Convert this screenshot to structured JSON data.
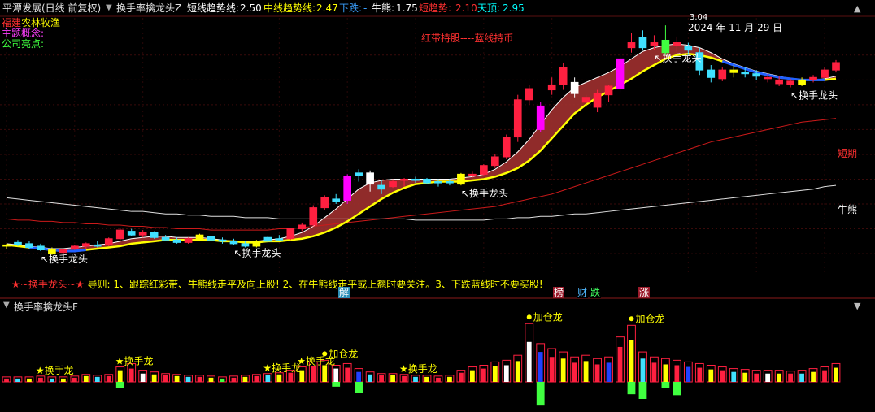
{
  "top_bar": {
    "stock_title": "平潭发展(日线 前复权)",
    "indicator_name": "换手率擒龙头Z",
    "readouts": [
      {
        "label": "短线趋势线:",
        "value": "2.50",
        "color": "#ffffff"
      },
      {
        "label": "中线趋势线:",
        "value": "2.47",
        "color": "#ffff00"
      },
      {
        "label": "下跌:",
        "value": "-",
        "color": "#3aa0ff"
      },
      {
        "label": "牛熊:",
        "value": "1.75",
        "color": "#ffffff"
      },
      {
        "label": "短趋势:",
        "value": "2.10",
        "color": "#ff3030"
      },
      {
        "label": "天顶:",
        "value": "2.95",
        "color": "#00ffff"
      }
    ]
  },
  "info_panel": {
    "industry_label": "福建",
    "industry_value": "农林牧渔",
    "theme_label": "主题概念:",
    "highlight_label": "公司亮点:"
  },
  "annotations": {
    "red_band_note": "红带持股----蓝线持币",
    "date_label": "2024 年 11 月 29 日",
    "peak_label": "3.04",
    "dragon_label": "换手龙头",
    "short_term_label": "短期",
    "bull_bear_label": "牛熊",
    "guide_star_text": "★~换手龙头~★",
    "guide_text": "导则: 1、跟踪红彩带、牛熊线走平及向上股! 2、在牛熊线走平或上翘时要关注。3、下跌蓝线时不要买股!",
    "bottom_tags": [
      {
        "text": "解",
        "bg": "#2d8fb8",
        "color": "#ffffff"
      },
      {
        "text": "榜",
        "bg": "#9a1a2a",
        "color": "#ffffff"
      },
      {
        "text": "财",
        "bg": "#000000",
        "color": "#4fb8ff"
      },
      {
        "text": "跌",
        "bg": "#000000",
        "color": "#40ff60"
      },
      {
        "text": "涨",
        "bg": "#9a1a2a",
        "color": "#ffffff"
      }
    ]
  },
  "sub_panel": {
    "title": "换手率擒龙头F",
    "add_label": "加仓龙",
    "dragon_label": "换手龙"
  },
  "controls": {
    "menu_icon": "chevron-down-icon",
    "up_icon": "caret-up-icon",
    "down_icon": "caret-down-icon"
  },
  "chart_data": {
    "type": "candlestick",
    "title": "",
    "xlabel": "",
    "ylabel": "",
    "ylim": [
      1.05,
      3.1
    ],
    "colors": {
      "up": "#ff2040",
      "down": "#40e0ff",
      "highlight_up": "#ff00ff",
      "highlight_down": "#ffffff",
      "signal": "#ffff00",
      "band": "#a0302f",
      "bear_line": "#2060ff",
      "short_trend": "#cc1a1a",
      "bull_bear": "#e0e0e0"
    },
    "candles": [
      {
        "o": 1.26,
        "h": 1.28,
        "l": 1.24,
        "c": 1.27,
        "t": "yellow"
      },
      {
        "o": 1.27,
        "h": 1.31,
        "l": 1.26,
        "c": 1.29,
        "t": "down"
      },
      {
        "o": 1.28,
        "h": 1.3,
        "l": 1.24,
        "c": 1.25,
        "t": "down"
      },
      {
        "o": 1.26,
        "h": 1.28,
        "l": 1.22,
        "c": 1.23,
        "t": "down"
      },
      {
        "o": 1.23,
        "h": 1.25,
        "l": 1.19,
        "c": 1.2,
        "t": "yellow"
      },
      {
        "o": 1.21,
        "h": 1.24,
        "l": 1.2,
        "c": 1.23,
        "t": "up"
      },
      {
        "o": 1.24,
        "h": 1.27,
        "l": 1.23,
        "c": 1.26,
        "t": "up"
      },
      {
        "o": 1.26,
        "h": 1.29,
        "l": 1.24,
        "c": 1.28,
        "t": "up"
      },
      {
        "o": 1.27,
        "h": 1.3,
        "l": 1.25,
        "c": 1.26,
        "t": "down"
      },
      {
        "o": 1.27,
        "h": 1.33,
        "l": 1.26,
        "c": 1.32,
        "t": "up"
      },
      {
        "o": 1.32,
        "h": 1.41,
        "l": 1.3,
        "c": 1.39,
        "t": "up"
      },
      {
        "o": 1.38,
        "h": 1.4,
        "l": 1.34,
        "c": 1.35,
        "t": "down"
      },
      {
        "o": 1.35,
        "h": 1.39,
        "l": 1.33,
        "c": 1.37,
        "t": "up"
      },
      {
        "o": 1.37,
        "h": 1.38,
        "l": 1.32,
        "c": 1.33,
        "t": "down"
      },
      {
        "o": 1.33,
        "h": 1.35,
        "l": 1.3,
        "c": 1.31,
        "t": "down"
      },
      {
        "o": 1.31,
        "h": 1.33,
        "l": 1.28,
        "c": 1.29,
        "t": "down"
      },
      {
        "o": 1.29,
        "h": 1.33,
        "l": 1.28,
        "c": 1.32,
        "t": "up"
      },
      {
        "o": 1.31,
        "h": 1.36,
        "l": 1.3,
        "c": 1.35,
        "t": "yellow"
      },
      {
        "o": 1.34,
        "h": 1.36,
        "l": 1.3,
        "c": 1.31,
        "t": "down"
      },
      {
        "o": 1.31,
        "h": 1.33,
        "l": 1.28,
        "c": 1.3,
        "t": "down"
      },
      {
        "o": 1.3,
        "h": 1.32,
        "l": 1.27,
        "c": 1.28,
        "t": "down"
      },
      {
        "o": 1.28,
        "h": 1.3,
        "l": 1.25,
        "c": 1.26,
        "t": "down"
      },
      {
        "o": 1.26,
        "h": 1.31,
        "l": 1.25,
        "c": 1.3,
        "t": "yellow"
      },
      {
        "o": 1.3,
        "h": 1.34,
        "l": 1.29,
        "c": 1.33,
        "t": "down"
      },
      {
        "o": 1.32,
        "h": 1.35,
        "l": 1.3,
        "c": 1.31,
        "t": "down"
      },
      {
        "o": 1.32,
        "h": 1.41,
        "l": 1.31,
        "c": 1.4,
        "t": "up"
      },
      {
        "o": 1.4,
        "h": 1.45,
        "l": 1.38,
        "c": 1.43,
        "t": "up"
      },
      {
        "o": 1.43,
        "h": 1.59,
        "l": 1.42,
        "c": 1.57,
        "t": "up"
      },
      {
        "o": 1.57,
        "h": 1.67,
        "l": 1.55,
        "c": 1.65,
        "t": "up"
      },
      {
        "o": 1.64,
        "h": 1.68,
        "l": 1.6,
        "c": 1.62,
        "t": "down"
      },
      {
        "o": 1.63,
        "h": 1.84,
        "l": 1.6,
        "c": 1.82,
        "t": "magenta"
      },
      {
        "o": 1.83,
        "h": 1.88,
        "l": 1.78,
        "c": 1.85,
        "t": "down"
      },
      {
        "o": 1.85,
        "h": 1.87,
        "l": 1.7,
        "c": 1.76,
        "t": "white"
      },
      {
        "o": 1.75,
        "h": 1.79,
        "l": 1.68,
        "c": 1.72,
        "t": "down"
      },
      {
        "o": 1.74,
        "h": 1.8,
        "l": 1.73,
        "c": 1.78,
        "t": "up"
      },
      {
        "o": 1.79,
        "h": 1.81,
        "l": 1.74,
        "c": 1.8,
        "t": "up"
      },
      {
        "o": 1.8,
        "h": 1.82,
        "l": 1.77,
        "c": 1.79,
        "t": "down"
      },
      {
        "o": 1.8,
        "h": 1.81,
        "l": 1.76,
        "c": 1.77,
        "t": "down"
      },
      {
        "o": 1.77,
        "h": 1.8,
        "l": 1.74,
        "c": 1.78,
        "t": "down"
      },
      {
        "o": 1.78,
        "h": 1.8,
        "l": 1.75,
        "c": 1.77,
        "t": "down"
      },
      {
        "o": 1.76,
        "h": 1.85,
        "l": 1.75,
        "c": 1.84,
        "t": "yellow"
      },
      {
        "o": 1.84,
        "h": 1.86,
        "l": 1.81,
        "c": 1.84,
        "t": "up"
      },
      {
        "o": 1.84,
        "h": 1.92,
        "l": 1.83,
        "c": 1.91,
        "t": "up"
      },
      {
        "o": 1.91,
        "h": 2.0,
        "l": 1.89,
        "c": 1.98,
        "t": "up"
      },
      {
        "o": 1.98,
        "h": 2.16,
        "l": 1.96,
        "c": 2.14,
        "t": "up"
      },
      {
        "o": 2.14,
        "h": 2.48,
        "l": 2.1,
        "c": 2.44,
        "t": "up"
      },
      {
        "o": 2.44,
        "h": 2.56,
        "l": 2.4,
        "c": 2.53,
        "t": "up"
      },
      {
        "o": 2.2,
        "h": 2.42,
        "l": 2.18,
        "c": 2.39,
        "t": "magenta"
      },
      {
        "o": 2.56,
        "h": 2.62,
        "l": 2.48,
        "c": 2.52,
        "t": "up"
      },
      {
        "o": 2.56,
        "h": 2.74,
        "l": 2.52,
        "c": 2.7,
        "t": "up"
      },
      {
        "o": 2.58,
        "h": 2.62,
        "l": 2.46,
        "c": 2.49,
        "t": "white"
      },
      {
        "o": 2.46,
        "h": 2.48,
        "l": 2.38,
        "c": 2.42,
        "t": "up"
      },
      {
        "o": 2.38,
        "h": 2.52,
        "l": 2.34,
        "c": 2.49,
        "t": "up"
      },
      {
        "o": 2.48,
        "h": 2.56,
        "l": 2.42,
        "c": 2.55,
        "t": "up"
      },
      {
        "o": 2.53,
        "h": 2.82,
        "l": 2.5,
        "c": 2.77,
        "t": "magenta"
      },
      {
        "o": 2.86,
        "h": 2.98,
        "l": 2.82,
        "c": 2.9,
        "t": "up"
      },
      {
        "o": 2.94,
        "h": 3.0,
        "l": 2.84,
        "c": 2.86,
        "t": "down"
      },
      {
        "o": 2.9,
        "h": 2.96,
        "l": 2.84,
        "c": 2.88,
        "t": "up"
      },
      {
        "o": 2.92,
        "h": 3.04,
        "l": 2.8,
        "c": 2.82,
        "t": "green"
      },
      {
        "o": 2.9,
        "h": 2.95,
        "l": 2.82,
        "c": 2.88,
        "t": "up"
      },
      {
        "o": 2.87,
        "h": 2.9,
        "l": 2.8,
        "c": 2.84,
        "t": "down"
      },
      {
        "o": 2.82,
        "h": 2.86,
        "l": 2.64,
        "c": 2.68,
        "t": "down"
      },
      {
        "o": 2.68,
        "h": 2.72,
        "l": 2.58,
        "c": 2.62,
        "t": "down"
      },
      {
        "o": 2.61,
        "h": 2.7,
        "l": 2.59,
        "c": 2.68,
        "t": "up"
      },
      {
        "o": 2.68,
        "h": 2.72,
        "l": 2.62,
        "c": 2.66,
        "t": "yellow"
      },
      {
        "o": 2.66,
        "h": 2.7,
        "l": 2.62,
        "c": 2.65,
        "t": "down"
      },
      {
        "o": 2.65,
        "h": 2.68,
        "l": 2.6,
        "c": 2.63,
        "t": "down"
      },
      {
        "o": 2.62,
        "h": 2.65,
        "l": 2.58,
        "c": 2.61,
        "t": "up"
      },
      {
        "o": 2.6,
        "h": 2.63,
        "l": 2.55,
        "c": 2.57,
        "t": "up"
      },
      {
        "o": 2.59,
        "h": 2.61,
        "l": 2.54,
        "c": 2.56,
        "t": "up"
      },
      {
        "o": 2.56,
        "h": 2.62,
        "l": 2.55,
        "c": 2.6,
        "t": "yellow"
      },
      {
        "o": 2.6,
        "h": 2.64,
        "l": 2.58,
        "c": 2.62,
        "t": "up"
      },
      {
        "o": 2.62,
        "h": 2.7,
        "l": 2.61,
        "c": 2.68,
        "t": "up"
      },
      {
        "o": 2.68,
        "h": 2.76,
        "l": 2.66,
        "c": 2.74,
        "t": "up"
      }
    ],
    "short_trend": [
      1.28,
      1.27,
      1.26,
      1.25,
      1.24,
      1.24,
      1.25,
      1.26,
      1.27,
      1.28,
      1.3,
      1.32,
      1.33,
      1.34,
      1.34,
      1.33,
      1.33,
      1.33,
      1.32,
      1.31,
      1.3,
      1.3,
      1.3,
      1.31,
      1.32,
      1.34,
      1.37,
      1.42,
      1.49,
      1.56,
      1.64,
      1.72,
      1.77,
      1.79,
      1.8,
      1.8,
      1.8,
      1.8,
      1.8,
      1.8,
      1.81,
      1.82,
      1.84,
      1.88,
      1.94,
      2.02,
      2.12,
      2.24,
      2.36,
      2.46,
      2.54,
      2.58,
      2.62,
      2.66,
      2.71,
      2.77,
      2.83,
      2.86,
      2.88,
      2.89,
      2.88,
      2.86,
      2.82,
      2.77,
      2.73,
      2.7,
      2.67,
      2.65,
      2.63,
      2.61,
      2.6,
      2.6,
      2.61,
      2.63
    ],
    "mid_trend": [
      1.27,
      1.26,
      1.25,
      1.24,
      1.23,
      1.22,
      1.22,
      1.23,
      1.24,
      1.25,
      1.26,
      1.28,
      1.29,
      1.3,
      1.31,
      1.31,
      1.31,
      1.31,
      1.31,
      1.3,
      1.3,
      1.29,
      1.29,
      1.3,
      1.3,
      1.31,
      1.32,
      1.34,
      1.37,
      1.41,
      1.46,
      1.52,
      1.58,
      1.64,
      1.69,
      1.73,
      1.76,
      1.77,
      1.78,
      1.78,
      1.78,
      1.79,
      1.8,
      1.82,
      1.85,
      1.89,
      1.95,
      2.03,
      2.13,
      2.23,
      2.33,
      2.4,
      2.46,
      2.51,
      2.56,
      2.61,
      2.67,
      2.72,
      2.77,
      2.8,
      2.81,
      2.8,
      2.78,
      2.75,
      2.72,
      2.69,
      2.66,
      2.64,
      2.62,
      2.61,
      2.6,
      2.6,
      2.6,
      2.61
    ],
    "bear_segments": [
      [
        2,
        7
      ],
      [
        63,
        72
      ]
    ],
    "short_term_ma": [
      1.48,
      1.47,
      1.47,
      1.46,
      1.46,
      1.45,
      1.45,
      1.44,
      1.44,
      1.43,
      1.43,
      1.42,
      1.42,
      1.41,
      1.41,
      1.4,
      1.4,
      1.4,
      1.39,
      1.39,
      1.39,
      1.39,
      1.39,
      1.39,
      1.4,
      1.4,
      1.41,
      1.42,
      1.43,
      1.44,
      1.45,
      1.46,
      1.47,
      1.48,
      1.49,
      1.5,
      1.51,
      1.52,
      1.53,
      1.54,
      1.55,
      1.56,
      1.57,
      1.58,
      1.6,
      1.62,
      1.64,
      1.66,
      1.68,
      1.71,
      1.74,
      1.77,
      1.8,
      1.83,
      1.86,
      1.89,
      1.92,
      1.95,
      1.98,
      2.01,
      2.04,
      2.07,
      2.1,
      2.12,
      2.14,
      2.16,
      2.18,
      2.2,
      2.22,
      2.24,
      2.26,
      2.27,
      2.28,
      2.29
    ],
    "bull_bear_ma": [
      1.65,
      1.64,
      1.63,
      1.62,
      1.61,
      1.6,
      1.59,
      1.58,
      1.57,
      1.56,
      1.55,
      1.54,
      1.54,
      1.53,
      1.52,
      1.52,
      1.51,
      1.51,
      1.5,
      1.5,
      1.5,
      1.49,
      1.49,
      1.49,
      1.48,
      1.48,
      1.48,
      1.48,
      1.48,
      1.48,
      1.48,
      1.48,
      1.48,
      1.48,
      1.48,
      1.48,
      1.47,
      1.47,
      1.47,
      1.47,
      1.47,
      1.47,
      1.47,
      1.48,
      1.48,
      1.49,
      1.49,
      1.5,
      1.5,
      1.51,
      1.52,
      1.52,
      1.53,
      1.54,
      1.55,
      1.56,
      1.57,
      1.58,
      1.59,
      1.6,
      1.61,
      1.62,
      1.63,
      1.64,
      1.65,
      1.66,
      1.67,
      1.68,
      1.69,
      1.7,
      1.71,
      1.72,
      1.74,
      1.75
    ],
    "dragon_signals": [
      3,
      20,
      40,
      57,
      69
    ],
    "sub_chart": {
      "type": "bar",
      "ylim": [
        -3,
        8
      ],
      "outer": [
        0.6,
        0.6,
        0.6,
        0.7,
        0.6,
        0.6,
        0.7,
        0.9,
        0.8,
        0.9,
        1.8,
        2.2,
        1.4,
        1.2,
        1.0,
        0.9,
        0.8,
        0.8,
        0.7,
        0.6,
        0.7,
        0.8,
        0.9,
        1.0,
        1.1,
        1.4,
        1.8,
        2.4,
        2.6,
        2.0,
        2.2,
        1.6,
        1.2,
        1.0,
        1.0,
        0.9,
        0.8,
        0.8,
        0.7,
        0.8,
        1.4,
        1.8,
        2.0,
        2.4,
        2.6,
        3.2,
        7.0,
        4.6,
        4.0,
        3.6,
        3.0,
        3.2,
        2.8,
        3.0,
        5.4,
        6.8,
        3.6,
        3.0,
        2.8,
        2.6,
        2.4,
        2.2,
        2.0,
        1.8,
        1.6,
        1.5,
        1.4,
        1.4,
        1.4,
        1.3,
        1.4,
        1.6,
        1.8,
        2.2
      ],
      "inner": [
        0.4,
        0.4,
        0.4,
        0.5,
        0.4,
        0.4,
        0.5,
        0.7,
        0.6,
        0.7,
        1.4,
        1.6,
        1.0,
        0.9,
        0.8,
        0.7,
        0.6,
        0.6,
        0.5,
        0.4,
        0.5,
        0.6,
        0.7,
        0.8,
        0.9,
        1.1,
        1.4,
        1.9,
        2.0,
        1.6,
        1.7,
        1.2,
        0.9,
        0.8,
        0.8,
        0.7,
        0.6,
        0.6,
        0.5,
        0.6,
        1.1,
        1.4,
        1.6,
        1.9,
        2.0,
        2.5,
        4.8,
        3.6,
        3.0,
        2.8,
        2.3,
        2.5,
        2.1,
        2.3,
        4.2,
        5.0,
        2.8,
        2.3,
        2.1,
        2.0,
        1.8,
        1.7,
        1.5,
        1.4,
        1.2,
        1.1,
        1.0,
        1.0,
        1.0,
        1.0,
        1.0,
        1.2,
        1.4,
        1.7
      ],
      "inner_kind": [
        "r",
        "c",
        "y",
        "r",
        "c",
        "y",
        "r",
        "y",
        "c",
        "r",
        "y",
        "r",
        "w",
        "y",
        "r",
        "y",
        "c",
        "r",
        "y",
        "g",
        "r",
        "y",
        "r",
        "c",
        "y",
        "r",
        "y",
        "r",
        "y",
        "w",
        "r",
        "b",
        "c",
        "r",
        "y",
        "r",
        "c",
        "y",
        "r",
        "y",
        "r",
        "y",
        "r",
        "y",
        "w",
        "y",
        "w",
        "b",
        "r",
        "y",
        "r",
        "y",
        "r",
        "b",
        "r",
        "y",
        "c",
        "r",
        "y",
        "r",
        "b",
        "r",
        "y",
        "r",
        "c",
        "y",
        "r",
        "w",
        "y",
        "r",
        "c",
        "y",
        "r",
        "y"
      ],
      "negative": [
        0,
        0,
        0,
        0,
        0,
        0,
        0,
        0,
        0,
        0,
        0.6,
        0,
        0,
        0,
        0,
        0,
        0,
        0,
        0,
        0,
        0,
        0,
        0,
        0,
        0,
        0,
        0,
        0,
        0,
        0,
        0,
        0,
        0,
        0,
        0,
        0,
        0,
        0,
        0,
        0,
        0,
        0,
        0,
        0,
        0,
        0,
        0,
        0,
        0,
        0,
        0,
        0,
        0,
        0,
        0,
        0,
        0,
        0,
        0,
        0,
        0,
        0,
        0,
        0,
        0,
        0,
        0,
        0,
        0,
        0,
        0,
        0,
        0,
        0
      ],
      "green_neg": [
        [
          10,
          0.6
        ],
        [
          29,
          0.5
        ],
        [
          31,
          1.2
        ],
        [
          47,
          2.5
        ],
        [
          55,
          1.3
        ],
        [
          56,
          1.8
        ],
        [
          58,
          0.6
        ],
        [
          59,
          1.4
        ]
      ],
      "labels": [
        {
          "i": 3,
          "text": "换手龙",
          "kind": "star"
        },
        {
          "i": 10,
          "text": "换手龙",
          "kind": "star"
        },
        {
          "i": 23,
          "text": "换手龙",
          "kind": "star"
        },
        {
          "i": 26,
          "text": "换手龙",
          "kind": "star"
        },
        {
          "i": 35,
          "text": "换手龙",
          "kind": "star"
        },
        {
          "i": 28,
          "text": "加仓龙",
          "kind": "dot"
        },
        {
          "i": 46,
          "text": "加仓龙",
          "kind": "dot"
        },
        {
          "i": 55,
          "text": "加仓龙",
          "kind": "dot"
        }
      ]
    }
  }
}
